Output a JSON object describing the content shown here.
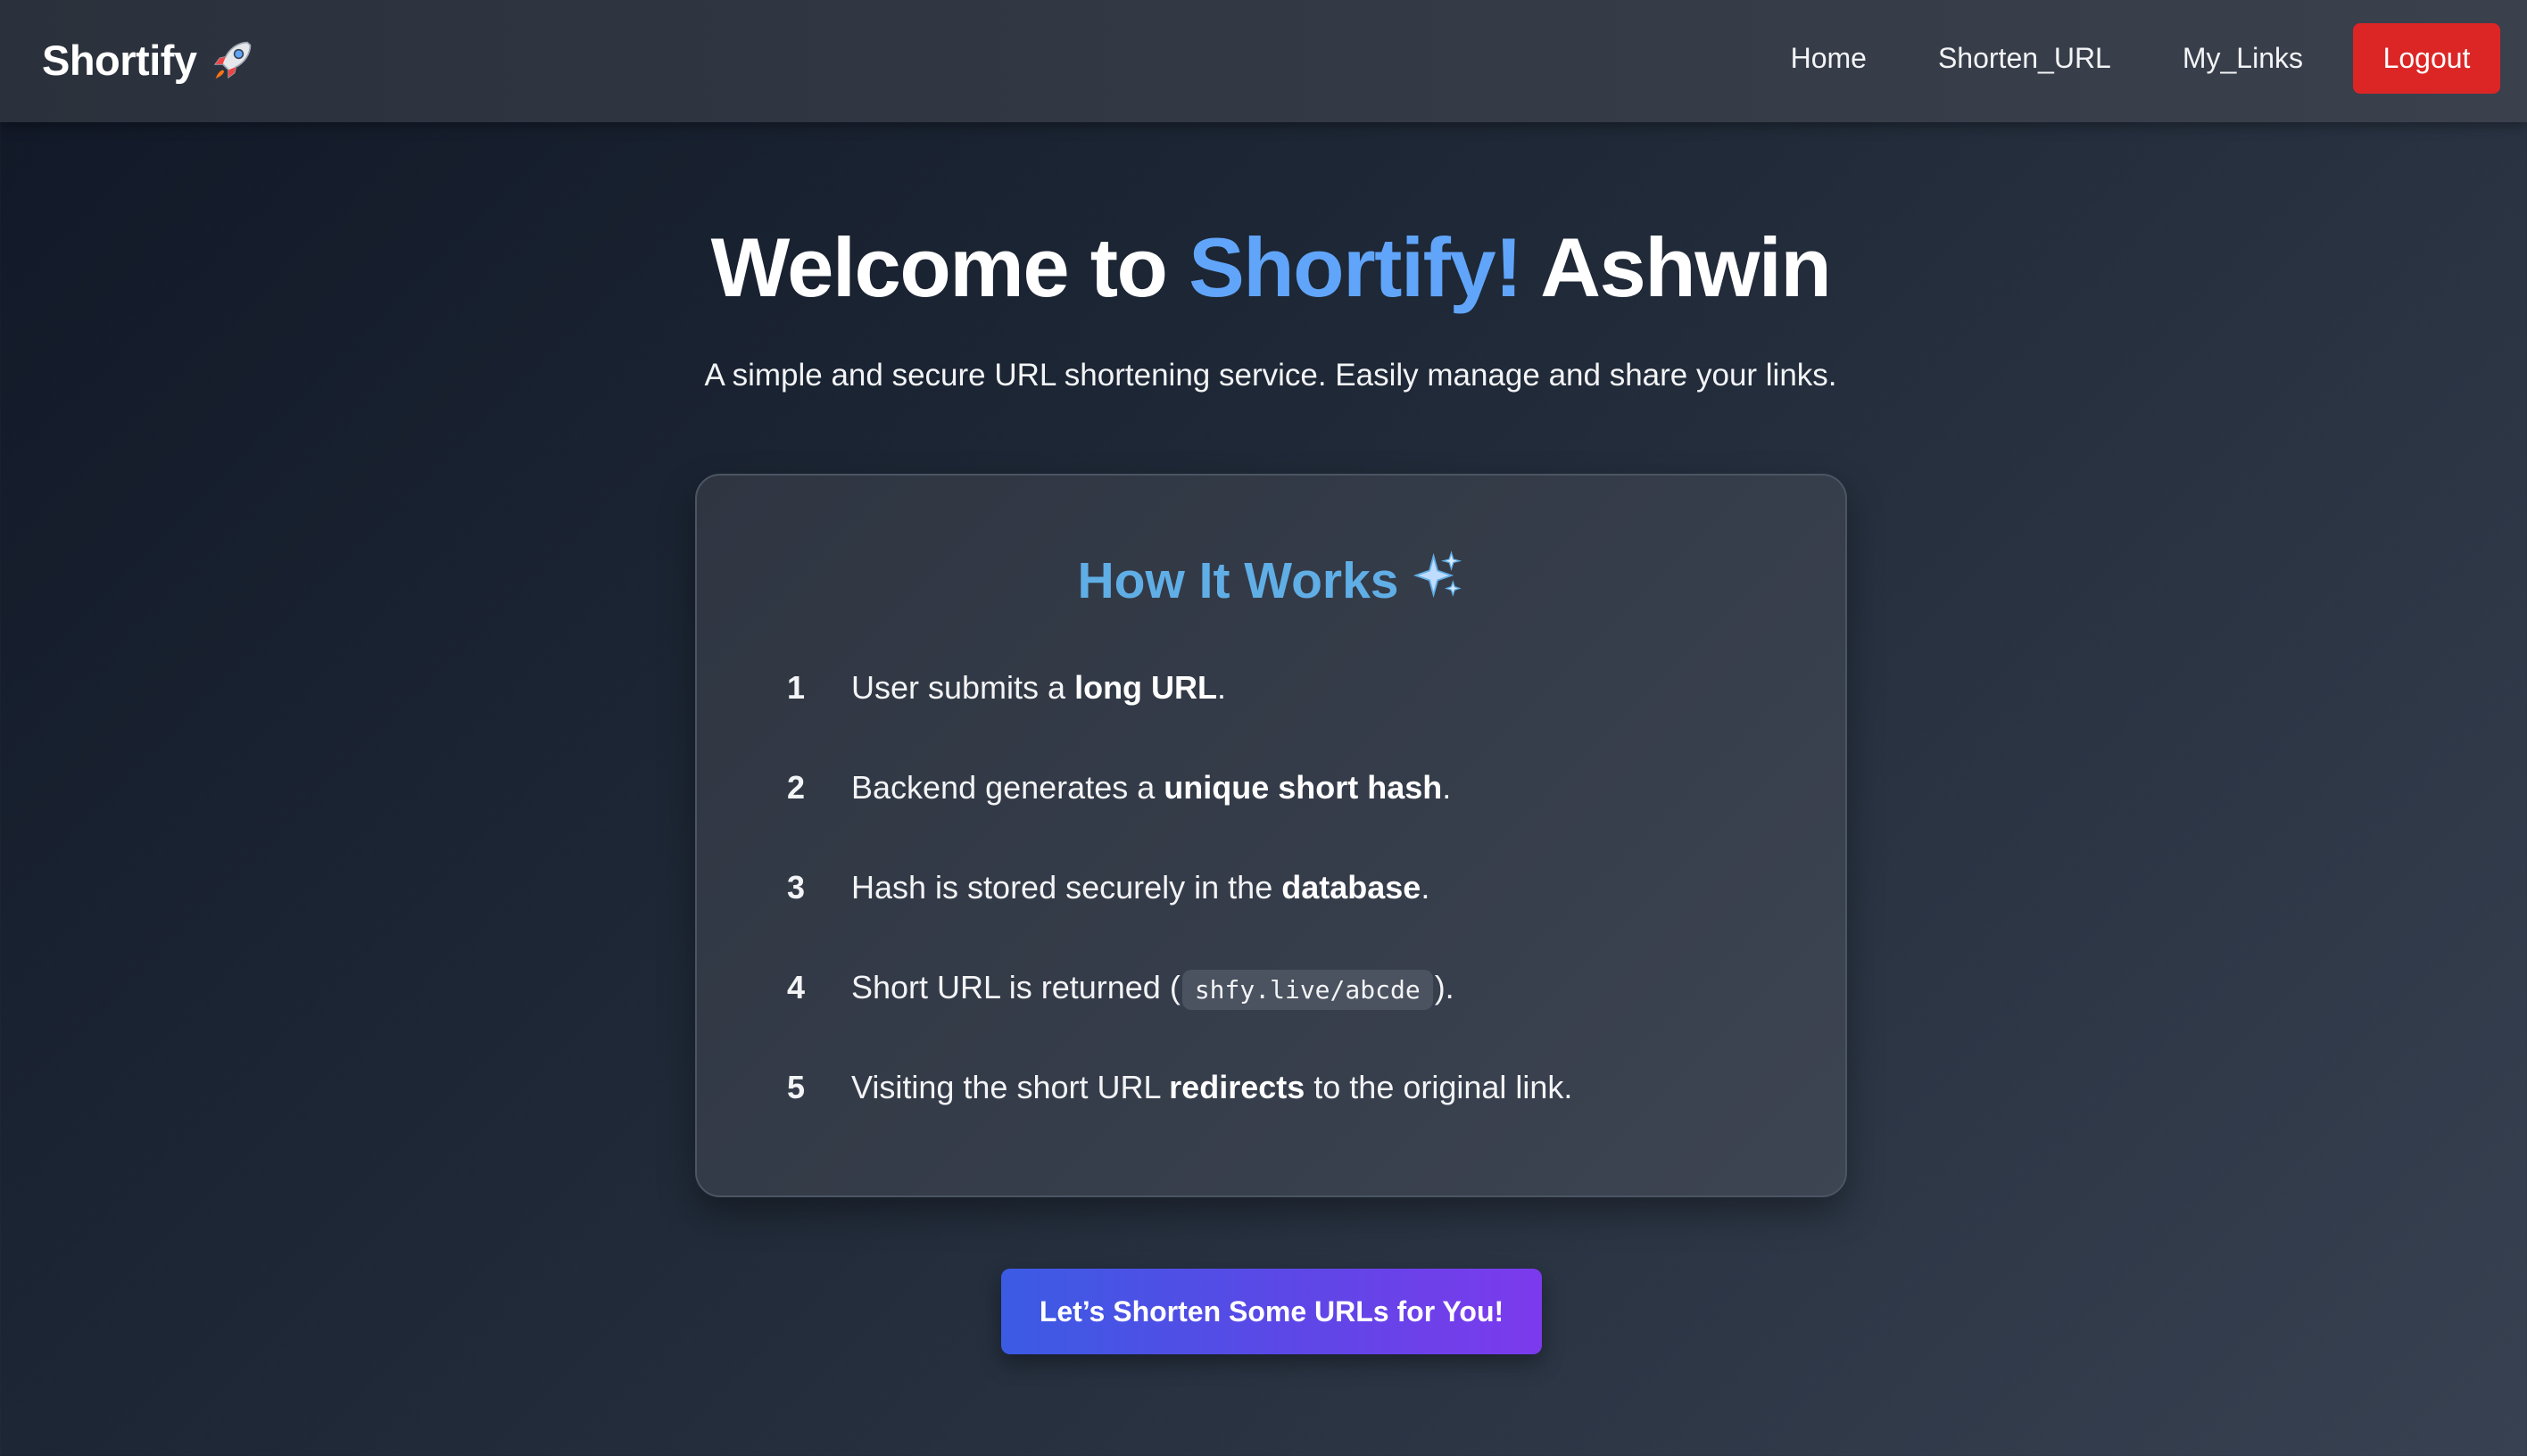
{
  "navbar": {
    "brand": "Shortify",
    "brand_icon": "rocket-icon",
    "links": [
      "Home",
      "Shorten_URL",
      "My_Links"
    ],
    "logout_label": "Logout",
    "logout_color": "#dc2626"
  },
  "hero": {
    "title_prefix": "Welcome to ",
    "title_accent": "Shortify!",
    "title_suffix": " Ashwin",
    "accent_color": "#60a5fa",
    "subtitle": "A simple and secure URL shortening service. Easily manage and share your links."
  },
  "how_it_works": {
    "title": "How It Works",
    "title_icon": "sparkles-icon",
    "steps": [
      {
        "number": "1",
        "text_before": "User submits a ",
        "bold": "long URL",
        "text_after": "."
      },
      {
        "number": "2",
        "text_before": "Backend generates a ",
        "bold": "unique short hash",
        "text_after": "."
      },
      {
        "number": "3",
        "text_before": "Hash is stored securely in the ",
        "bold": "database",
        "text_after": "."
      },
      {
        "number": "4",
        "text_before": "Short URL is returned (",
        "code": "shfy.live/abcde",
        "text_after": ")."
      },
      {
        "number": "5",
        "text_before": "Visiting the short URL ",
        "bold": "redirects",
        "text_after": " to the original link."
      }
    ]
  },
  "cta": {
    "label": "Let’s Shorten Some URLs for You!"
  }
}
